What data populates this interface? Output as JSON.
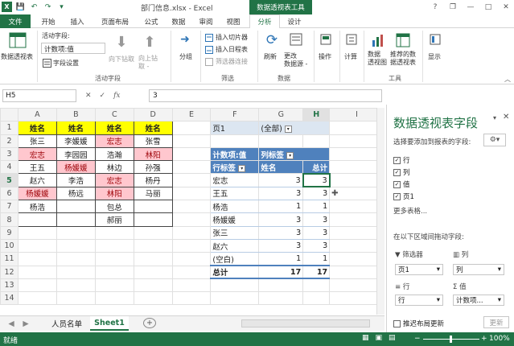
{
  "title": {
    "text": "部门信息.xlsx - Excel",
    "pivot_tools": "数据透视表工具"
  },
  "qat": {
    "save": "💾",
    "undo": "↶",
    "redo": "↷"
  },
  "window": {
    "help": "?",
    "restore": "❐",
    "minimize": "—",
    "maximize": "□",
    "close": "✕"
  },
  "tabs": {
    "file": "文件",
    "home": "开始",
    "insert": "插入",
    "layout": "页面布局",
    "formula": "公式",
    "data": "数据",
    "review": "审阅",
    "view": "视图",
    "analyze": "分析",
    "design": "设计"
  },
  "ribbon": {
    "pivot_label": "数据透视表",
    "active_field_label": "活动字段:",
    "active_field_value": "计数项:值",
    "field_settings": "字段设置",
    "drill_down": "向下钻取",
    "drill_up": "向上钻\n取 -",
    "group_active": "活动字段",
    "group_btn": "分组",
    "insert_slicer": "插入切片器",
    "insert_timeline": "插入日程表",
    "filter_conn": "筛选器连接",
    "group_filter": "筛选",
    "refresh": "刷新",
    "change_source": "更改\n数据源 -",
    "group_data": "数据",
    "actions": "操作",
    "calculations": "计算",
    "pivotchart": "数据\n透视图",
    "recommended": "推荐的数\n据透视表",
    "group_tools": "工具",
    "show": "显示"
  },
  "formula_bar": {
    "name_box": "H5",
    "cancel": "✕",
    "enter": "✓",
    "fx": "fx",
    "value": "3"
  },
  "columns": [
    "A",
    "B",
    "C",
    "D",
    "E",
    "F",
    "G",
    "H",
    "I"
  ],
  "rows": [
    "1",
    "2",
    "3",
    "4",
    "5",
    "6",
    "7",
    "8",
    "9",
    "10",
    "11",
    "12",
    "13",
    "14"
  ],
  "sheet": {
    "headers": [
      "姓名",
      "姓名",
      "姓名",
      "姓名"
    ],
    "colA": [
      "张三",
      "宏志",
      "王五",
      "赵六",
      "杨媛媛",
      "杨浩",
      ""
    ],
    "colB": [
      "李媛媛",
      "李园园",
      "杨媛媛",
      "李浩",
      "杨远",
      "",
      ""
    ],
    "colC": [
      "宏志",
      "浩瀚",
      "林边",
      "宏志",
      "林阳",
      "包总",
      "郝丽"
    ],
    "colD": [
      "张雪",
      "林阳",
      "孙强",
      "杨丹",
      "马丽",
      "",
      ""
    ]
  },
  "pivot": {
    "filter_label": "页1",
    "filter_value": "(全部)",
    "count_label": "计数项:值",
    "col_label": "列标签",
    "row_label": "行标签",
    "col_name": "姓名",
    "total_col": "总计",
    "rows": [
      {
        "label": "宏志",
        "v1": "3",
        "v2": "3"
      },
      {
        "label": "王五",
        "v1": "3",
        "v2": "3"
      },
      {
        "label": "杨浩",
        "v1": "1",
        "v2": "1"
      },
      {
        "label": "杨媛媛",
        "v1": "3",
        "v2": "3"
      },
      {
        "label": "张三",
        "v1": "3",
        "v2": "3"
      },
      {
        "label": "赵六",
        "v1": "3",
        "v2": "3"
      },
      {
        "label": "(空白)",
        "v1": "1",
        "v2": "1"
      }
    ],
    "grand_label": "总计",
    "grand_v1": "17",
    "grand_v2": "17"
  },
  "panel": {
    "title": "数据透视表字段",
    "choose": "选择要添加到报表的字段:",
    "fields": [
      {
        "label": "行",
        "checked": true
      },
      {
        "label": "列",
        "checked": true
      },
      {
        "label": "值",
        "checked": true
      },
      {
        "label": "页1",
        "checked": true
      }
    ],
    "more_tables": "更多表格...",
    "drag_label": "在以下区域间拖动字段:",
    "filter_zone": "筛选器",
    "column_zone": "列",
    "row_zone": "行",
    "value_zone": "值",
    "filter_item": "页1",
    "column_item": "列",
    "row_item": "行",
    "value_item": "计数项...",
    "defer": "推迟布局更新",
    "update": "更新"
  },
  "sheet_tabs": {
    "tab1": "人员名单",
    "tab2": "Sheet1",
    "add": "+"
  },
  "status": {
    "ready": "就绪",
    "zoom": "100%"
  }
}
